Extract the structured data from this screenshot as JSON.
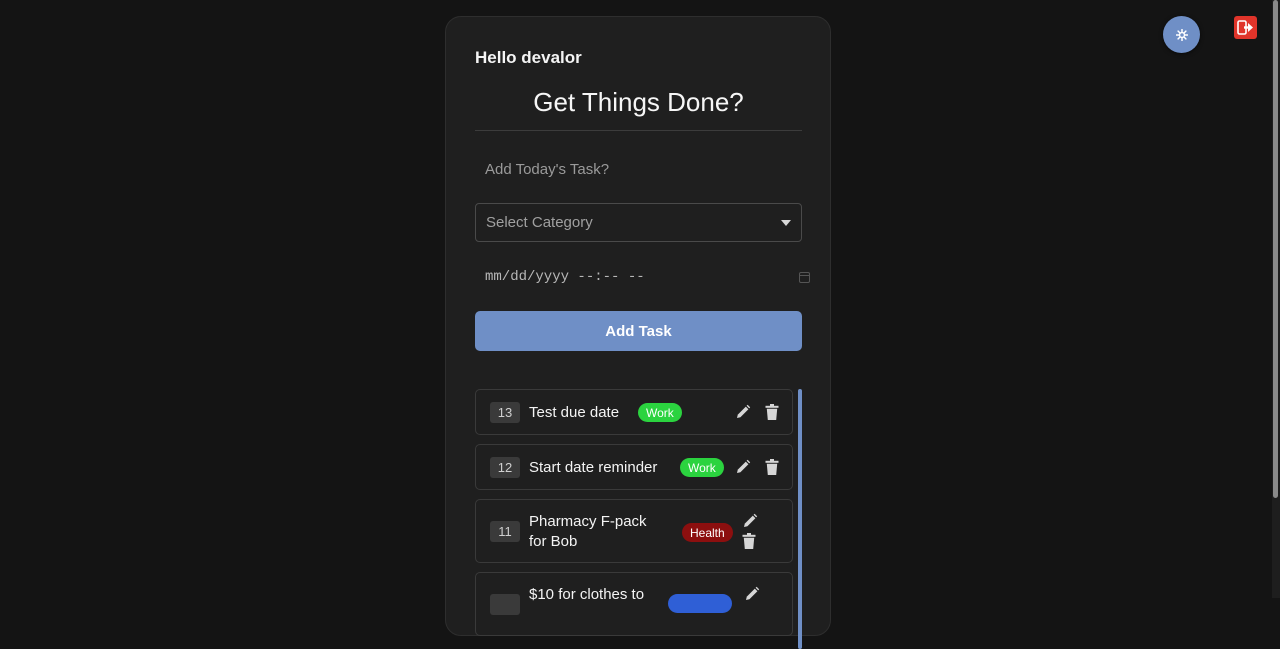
{
  "header": {
    "theme_toggle_icon": "gear-icon",
    "logout_icon": "logout-icon",
    "logout_color": "#e0342a",
    "toggle_color": "#6f8fc6"
  },
  "card": {
    "greeting": "Hello devalor",
    "title": "Get Things Done?",
    "task_placeholder": "Add Today's Task?",
    "category_value": "Select Category",
    "datetime_value": "mm/dd/yyyy --:-- --",
    "add_button_label": "Add Task"
  },
  "tasks": [
    {
      "number": "13",
      "name": "Test due date",
      "category": "Work",
      "category_color": "#2bd33f"
    },
    {
      "number": "12",
      "name": "Start date reminder",
      "category": "Work",
      "category_color": "#2bd33f"
    },
    {
      "number": "11",
      "name": "Pharmacy F-pack for Bob",
      "name_line1": "Pharmacy F-pack",
      "name_line2": "for Bob",
      "category": "Health",
      "category_color": "#8c0f0f"
    },
    {
      "number": "",
      "name": "$10 for clothes to",
      "category": "",
      "category_color": "#2f5fd6"
    }
  ]
}
